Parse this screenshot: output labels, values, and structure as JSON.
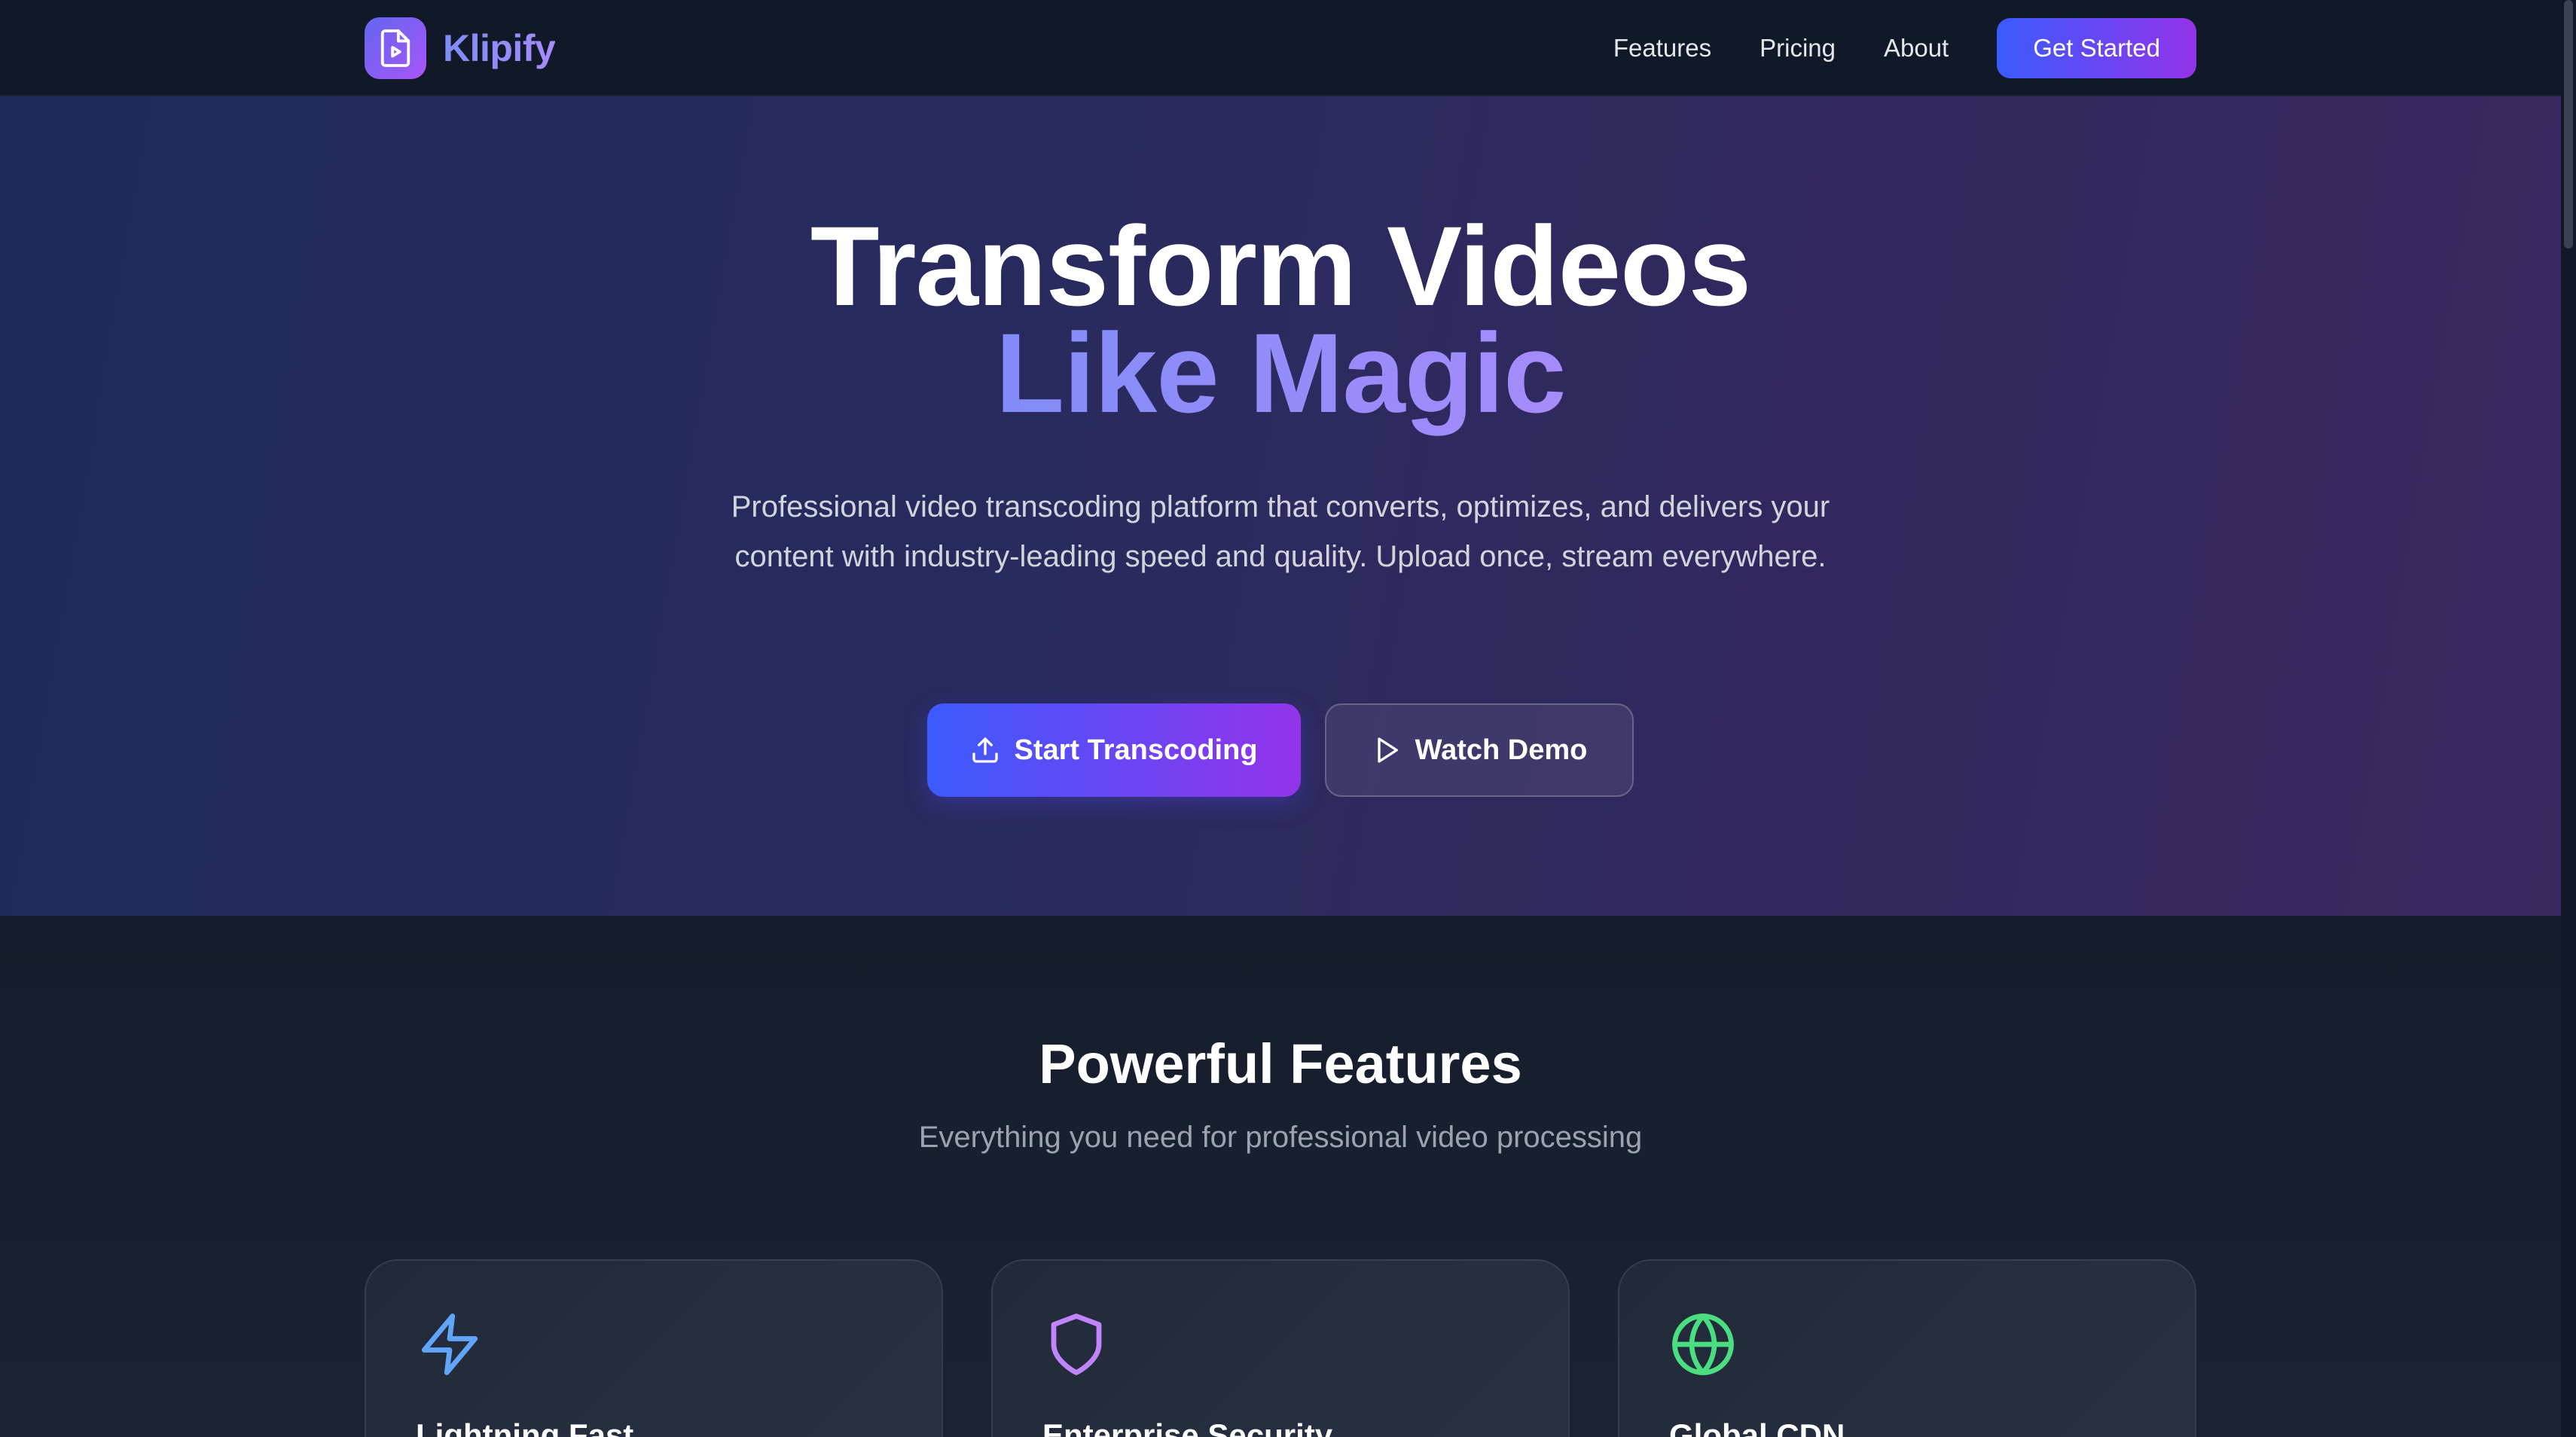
{
  "brand": {
    "name": "Klipify",
    "logo_icon": "video-file-icon",
    "accent": "#6366f1"
  },
  "nav": {
    "links": [
      "Features",
      "Pricing",
      "About"
    ],
    "cta": "Get Started"
  },
  "hero": {
    "title_line1": "Transform Videos",
    "title_line2": "Like Magic",
    "subtitle": "Professional video transcoding platform that converts, optimizes, and delivers your content with industry-leading speed and quality. Upload once, stream everywhere.",
    "primary_button": {
      "label": "Start Transcoding",
      "icon": "upload-icon"
    },
    "secondary_button": {
      "label": "Watch Demo",
      "icon": "play-icon"
    }
  },
  "features": {
    "title": "Powerful Features",
    "subtitle": "Everything you need for professional video processing",
    "cards": [
      {
        "title": "Lightning Fast",
        "icon": "lightning-icon",
        "color": "#60a5fa"
      },
      {
        "title": "Enterprise Security",
        "icon": "shield-icon",
        "color": "#c084fc"
      },
      {
        "title": "Global CDN",
        "icon": "globe-icon",
        "color": "#4ade80"
      }
    ]
  }
}
